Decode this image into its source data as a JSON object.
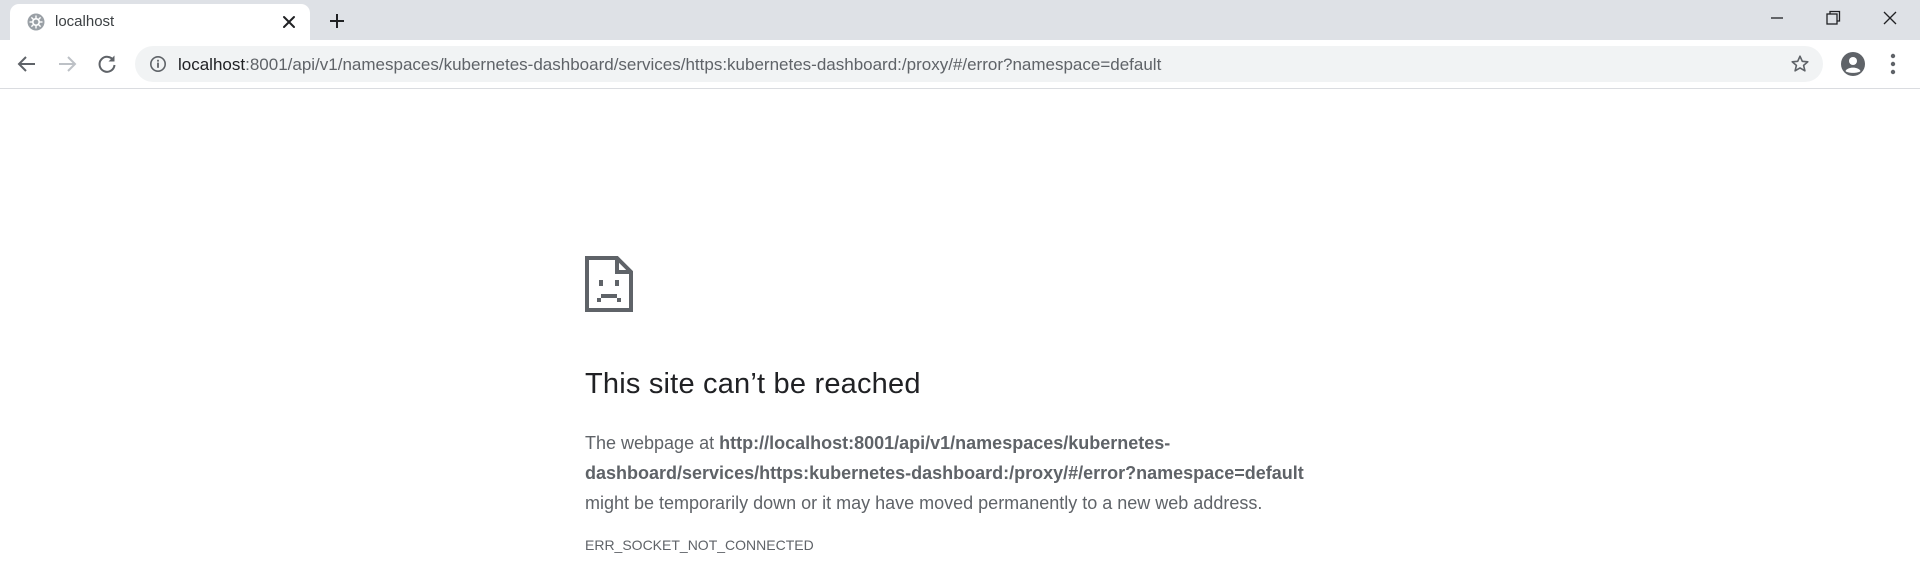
{
  "browser": {
    "tab": {
      "title": "localhost",
      "favicon": "kubernetes-helm-icon"
    },
    "window_controls": [
      "minimize-icon",
      "restore-icon",
      "close-icon"
    ],
    "address_bar": {
      "host": "localhost",
      "rest": ":8001/api/v1/namespaces/kubernetes-dashboard/services/https:kubernetes-dashboard:/proxy/#/error?namespace=default"
    }
  },
  "error_page": {
    "icon": "sad-page-icon",
    "title": "This site can’t be reached",
    "desc_prefix": "The webpage at ",
    "desc_url_line1": "http://localhost:8001/api/v1/namespaces/kubernetes-",
    "desc_url_line2": "dashboard/services/https:kubernetes-dashboard:/proxy/#/error?namespace=default",
    "desc_suffix": "might be temporarily down or it may have moved permanently to a new web address.",
    "error_code": "ERR_SOCKET_NOT_CONNECTED"
  },
  "colors": {
    "tabstrip_bg": "#dee1e6",
    "omnibox_bg": "#f1f3f4",
    "text_primary": "#202124",
    "text_secondary": "#5f6368"
  }
}
